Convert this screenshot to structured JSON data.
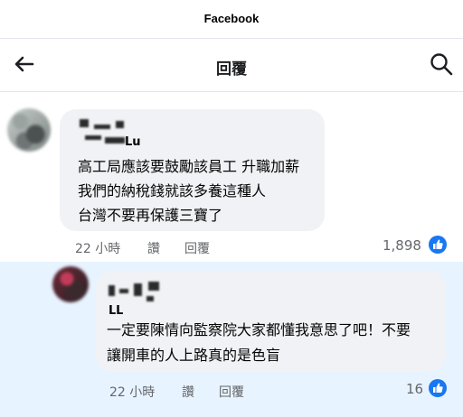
{
  "app": {
    "title": "Facebook"
  },
  "nav": {
    "title": "回覆",
    "back_icon": "back-arrow-icon",
    "search_icon": "search-icon"
  },
  "comment": {
    "author_partial": "Lu",
    "lines": [
      "高工局應該要鼓勵該員工 升職加薪",
      "我們的納稅錢就該多養這種人",
      "台灣不要再保護三寶了"
    ],
    "time": "22 小時",
    "like_label": "讚",
    "reply_label": "回覆",
    "reaction_count": "1,898"
  },
  "reply": {
    "author_partial": "ᒪᒪ",
    "lines": [
      "一定要陳情向監察院大家都懂我意思了吧！不要",
      "讓開車的人上路真的是色盲"
    ],
    "time": "22 小時",
    "like_label": "讚",
    "reply_label": "回覆",
    "reaction_count": "16"
  },
  "colors": {
    "accent": "#1877f2",
    "bubble": "#f0f2f5",
    "highlight": "#e7f3ff",
    "meta_text": "#65676b"
  }
}
